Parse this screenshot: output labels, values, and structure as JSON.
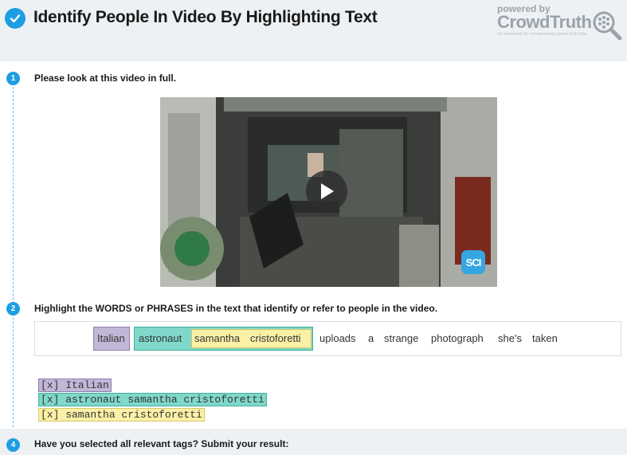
{
  "header": {
    "title": "Identify People In Video By Highlighting Text",
    "brand_powered": "powered by",
    "brand_name": "CrowdTruth",
    "brand_tagline": "the framework for crowdsourcing ground truth data",
    "accent_color": "#1e9ee2"
  },
  "steps": [
    {
      "number": "1",
      "text": "Please look at this video in full."
    },
    {
      "number": "2",
      "text": "Highlight the WORDS or PHRASES in the text that identify or refer to people in the video."
    },
    {
      "number": "4",
      "text": "Have you selected all relevant tags? Submit your result:"
    }
  ],
  "video": {
    "play_icon": "play-icon",
    "badge": "SCI"
  },
  "sentence": {
    "tokens": [
      "Italian",
      "astronaut",
      "samantha",
      "cristoforetti",
      "uploads",
      "a",
      "strange",
      "photograph",
      "she's",
      "taken"
    ]
  },
  "highlights": [
    {
      "color": "#c3b7d8",
      "span": "Italian"
    },
    {
      "color": "#7fd8c9",
      "span": "astronaut samantha cristoforetti"
    },
    {
      "color": "#fbf0a6",
      "span": "samantha cristoforetti"
    }
  ],
  "selected_tags": [
    {
      "label": "[x] Italian"
    },
    {
      "label": "[x] astronaut samantha cristoforetti"
    },
    {
      "label": "[x] samantha cristoforetti"
    }
  ]
}
